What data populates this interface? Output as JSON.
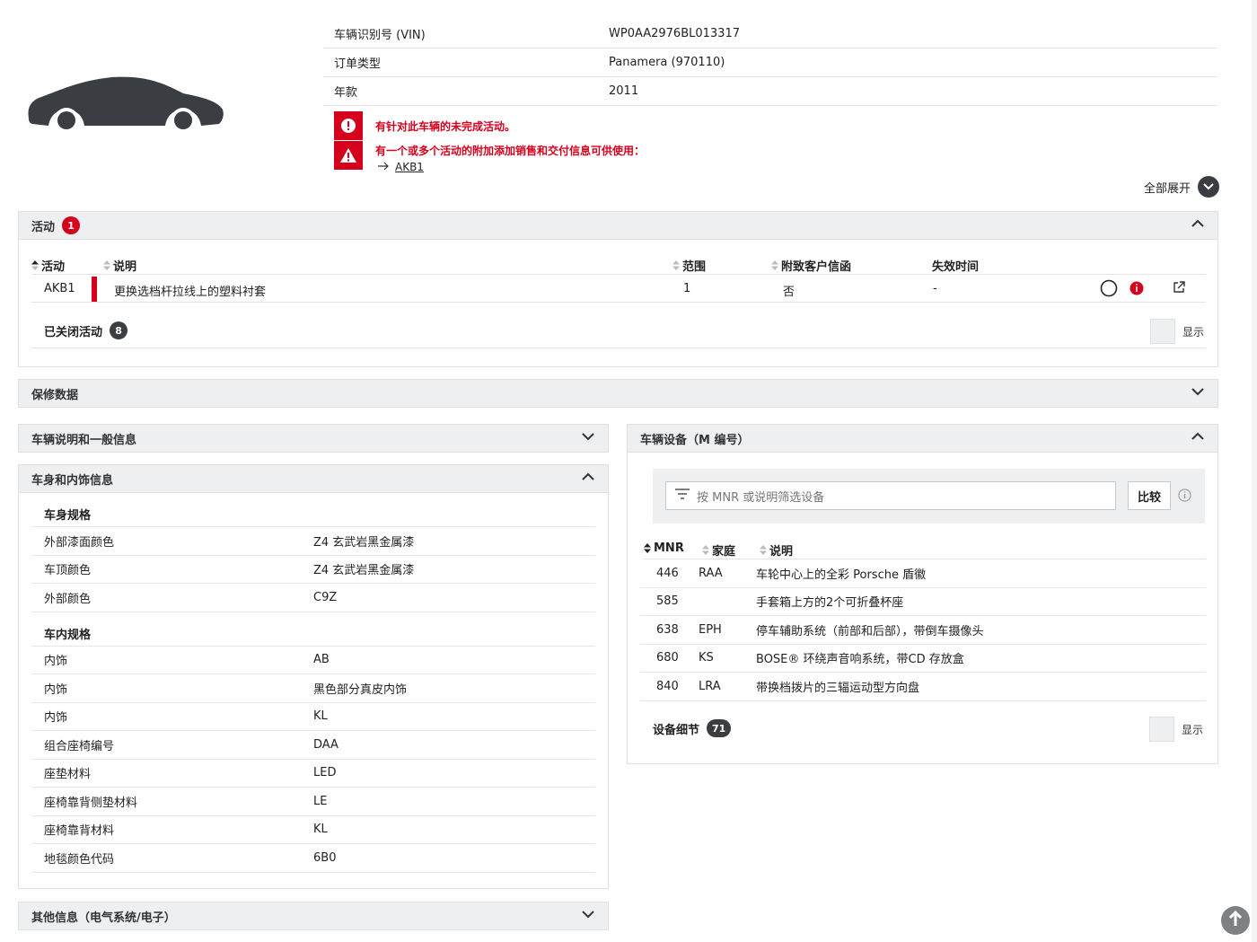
{
  "vehicle": {
    "vin_label": "车辆识别号 (VIN)",
    "vin_value": "WP0AA2976BL013317",
    "order_type_label": "订单类型",
    "order_type_value": "Panamera (970110)",
    "model_year_label": "年款",
    "model_year_value": "2011"
  },
  "alerts": {
    "open_campaign": "有针对此车辆的未完成活动。",
    "additional_info": "有一个或多个活动的附加添加销售和交付信息可供使用：",
    "link": "AKB1"
  },
  "expand_all_label": "全部展开",
  "campaigns": {
    "title": "活动",
    "count": "1",
    "columns": [
      "活动",
      "说明",
      "范围",
      "附致客户信函",
      "失效时间"
    ],
    "rows": [
      {
        "id": "AKB1",
        "description": "更换选档杆拉线上的塑料衬套",
        "scope": "1",
        "letter": "否",
        "expiry": "-"
      }
    ],
    "closed_label": "已关闭活动",
    "closed_count": "8",
    "show_label": "显示"
  },
  "warranty": {
    "title": "保修数据"
  },
  "general_info": {
    "title": "车辆说明和一般信息"
  },
  "body_interior": {
    "title": "车身和内饰信息",
    "body_spec_title": "车身规格",
    "body_spec": [
      {
        "k": "外部漆面颜色",
        "v": "Z4 玄武岩黑金属漆"
      },
      {
        "k": "车顶颜色",
        "v": "Z4 玄武岩黑金属漆"
      },
      {
        "k": "外部颜色",
        "v": "C9Z"
      }
    ],
    "interior_spec_title": "车内规格",
    "interior_spec": [
      {
        "k": "内饰",
        "v": "AB"
      },
      {
        "k": "内饰",
        "v": "黑色部分真皮内饰"
      },
      {
        "k": "内饰",
        "v": "KL"
      },
      {
        "k": "组合座椅编号",
        "v": "DAA"
      },
      {
        "k": "座垫材料",
        "v": "LED"
      },
      {
        "k": "座椅靠背侧垫材料",
        "v": "LE"
      },
      {
        "k": "座椅靠背材料",
        "v": "KL"
      },
      {
        "k": "地毯颜色代码",
        "v": "6B0"
      }
    ]
  },
  "other_info": {
    "title": "其他信息（电气系统/电子）"
  },
  "equipment": {
    "title": "车辆设备（M 编号）",
    "search_placeholder": "按 MNR 或说明筛选设备",
    "compare_label": "比较",
    "columns": [
      "MNR",
      "家庭",
      "说明"
    ],
    "rows": [
      {
        "mnr": "446",
        "family": "RAA",
        "desc": "车轮中心上的全彩 Porsche 盾徽"
      },
      {
        "mnr": "585",
        "family": "",
        "desc": "手套箱上方的2个可折叠杯座"
      },
      {
        "mnr": "638",
        "family": "EPH",
        "desc": "停车辅助系统（前部和后部），带倒车摄像头"
      },
      {
        "mnr": "680",
        "family": "KS",
        "desc": "BOSE® 环绕声音响系统，带CD 存放盒"
      },
      {
        "mnr": "840",
        "family": "LRA",
        "desc": "带换档拨片的三辐运动型方向盘"
      }
    ],
    "details_label": "设备细节",
    "details_count": "71",
    "show_label": "显示"
  },
  "icons": {
    "car": "car-silhouette-icon",
    "alert_exclamation": "exclamation-icon",
    "alert_warning": "warning-triangle-icon",
    "arrow": "arrow-right-icon",
    "chevron": "chevron-icon",
    "filter": "filter-icon",
    "info": "info-icon",
    "external": "external-link-icon",
    "scroll_top": "arrow-up-icon"
  },
  "colors": {
    "accent_red": "#d5001c",
    "header_gray": "#eeeff1",
    "dark": "#3a3d42"
  }
}
